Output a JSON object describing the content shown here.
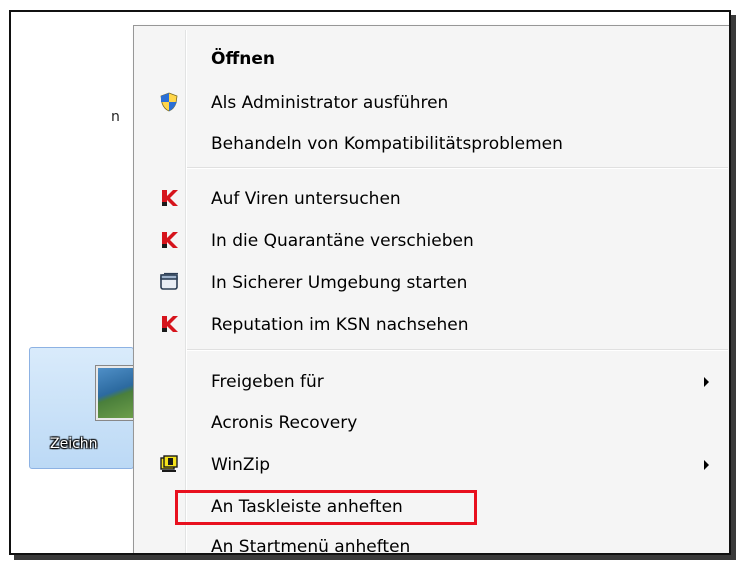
{
  "desktop": {
    "fragment_text": "n",
    "icon_label": "Zeichn"
  },
  "menu": {
    "items": [
      {
        "label": "Öffnen",
        "icon": "none",
        "bold": true,
        "submenu": false
      },
      {
        "label": "Als Administrator ausführen",
        "icon": "uac-shield-icon",
        "submenu": false
      },
      {
        "label": "Behandeln von Kompatibilitätsproblemen",
        "icon": "none",
        "submenu": false
      },
      {
        "label": "Auf Viren untersuchen",
        "icon": "kaspersky-icon",
        "submenu": false
      },
      {
        "label": "In die Quarantäne verschieben",
        "icon": "kaspersky-icon",
        "submenu": false
      },
      {
        "label": "In Sicherer Umgebung starten",
        "icon": "window-icon",
        "submenu": false
      },
      {
        "label": "Reputation im KSN nachsehen",
        "icon": "kaspersky-icon",
        "submenu": false
      },
      {
        "label": "Freigeben für",
        "icon": "none",
        "submenu": true
      },
      {
        "label": "Acronis Recovery",
        "icon": "none",
        "submenu": false
      },
      {
        "label": "WinZip",
        "icon": "winzip-icon",
        "submenu": true
      },
      {
        "label": "An Taskleiste anheften",
        "icon": "none",
        "submenu": false,
        "highlighted": true
      },
      {
        "label": "An Startmenü anheften",
        "icon": "none",
        "submenu": false
      }
    ]
  },
  "colors": {
    "highlight_border": "#e8101e",
    "menu_background": "#f5f5f5",
    "kaspersky_red": "#d6141c"
  }
}
